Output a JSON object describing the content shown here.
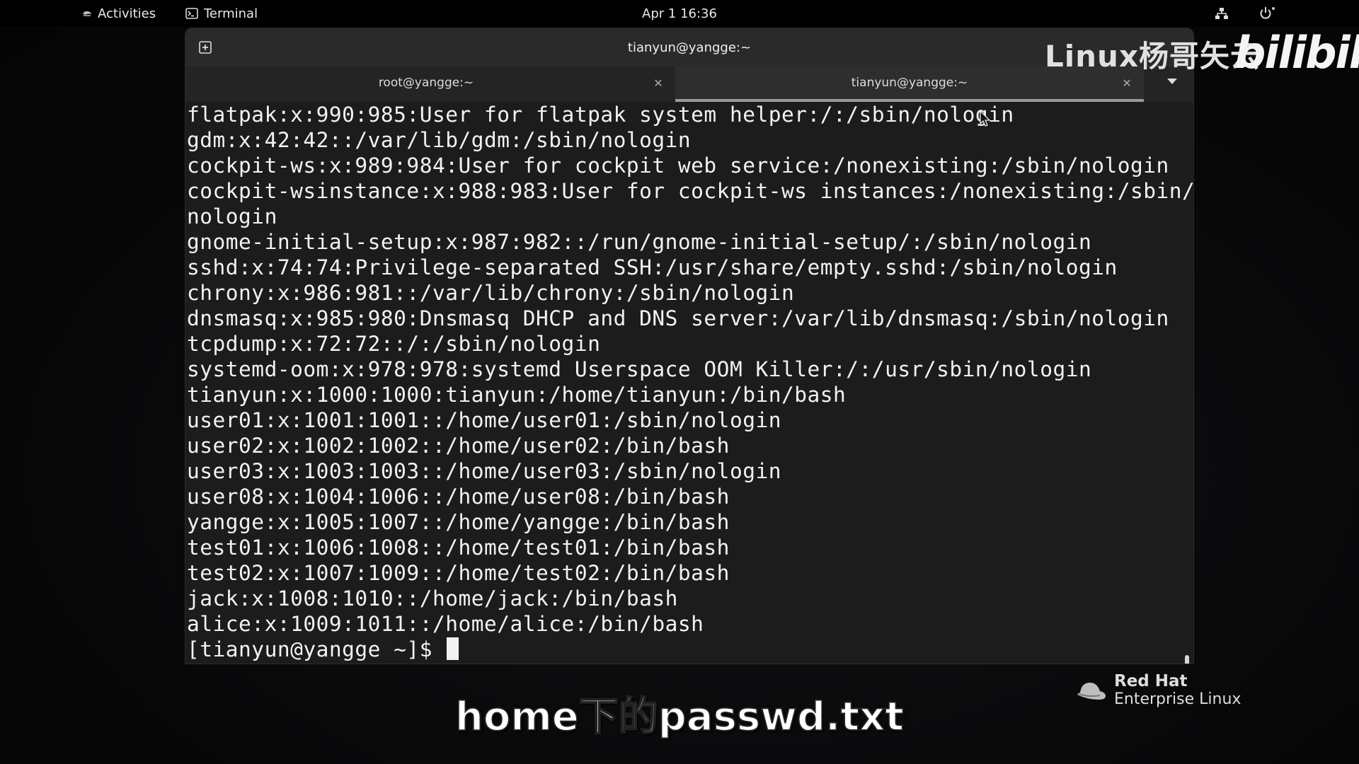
{
  "topbar": {
    "activities": "Activities",
    "app_name": "Terminal",
    "clock": "Apr 1  16:36",
    "network_icon": "network-icon",
    "power_icon": "power-icon"
  },
  "window": {
    "title": "tianyun@yangge:~",
    "tabs": [
      {
        "label": "root@yangge:~",
        "active": false
      },
      {
        "label": "tianyun@yangge:~",
        "active": true
      }
    ]
  },
  "terminal": {
    "lines": [
      "flatpak:x:990:985:User for flatpak system helper:/:/sbin/nologin",
      "gdm:x:42:42::/var/lib/gdm:/sbin/nologin",
      "cockpit-ws:x:989:984:User for cockpit web service:/nonexisting:/sbin/nologin",
      "cockpit-wsinstance:x:988:983:User for cockpit-ws instances:/nonexisting:/sbin/",
      "nologin",
      "gnome-initial-setup:x:987:982::/run/gnome-initial-setup/:/sbin/nologin",
      "sshd:x:74:74:Privilege-separated SSH:/usr/share/empty.sshd:/sbin/nologin",
      "chrony:x:986:981::/var/lib/chrony:/sbin/nologin",
      "dnsmasq:x:985:980:Dnsmasq DHCP and DNS server:/var/lib/dnsmasq:/sbin/nologin",
      "tcpdump:x:72:72::/:/sbin/nologin",
      "systemd-oom:x:978:978:systemd Userspace OOM Killer:/:/usr/sbin/nologin",
      "tianyun:x:1000:1000:tianyun:/home/tianyun:/bin/bash",
      "user01:x:1001:1001::/home/user01:/sbin/nologin",
      "user02:x:1002:1002::/home/user02:/bin/bash",
      "user03:x:1003:1003::/home/user03:/sbin/nologin",
      "user08:x:1004:1006::/home/user08:/bin/bash",
      "yangge:x:1005:1007::/home/yangge:/bin/bash",
      "test01:x:1006:1008::/home/test01:/bin/bash",
      "test02:x:1007:1009::/home/test02:/bin/bash",
      "jack:x:1008:1010::/home/jack:/bin/bash",
      "alice:x:1009:1011::/home/alice:/bin/bash"
    ],
    "prompt": "[tianyun@yangge ~]$ "
  },
  "watermark": {
    "channel": "Linux杨哥矢云",
    "site_logo": "bilibili"
  },
  "redhat": {
    "brand": "Red Hat",
    "product": "Enterprise Linux"
  },
  "subtitle": "home下的passwd.txt"
}
